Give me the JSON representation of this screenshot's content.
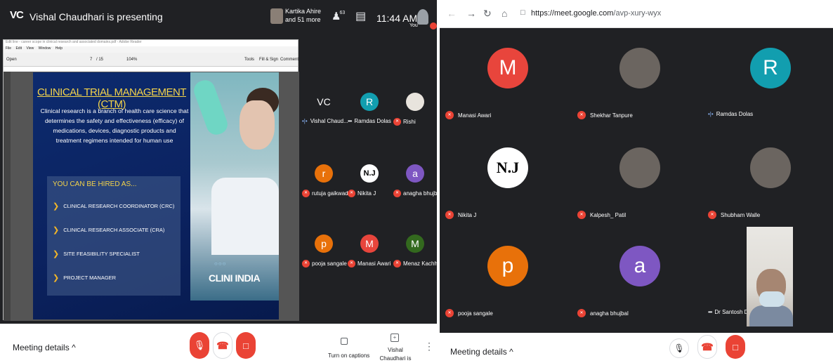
{
  "left": {
    "header": {
      "logo": "VC",
      "presenting_title": "Vishal Chaudhari is presenting",
      "participants_line1": "Kartika Ahire",
      "participants_line2": "and 51 more",
      "people_icon": "people-icon",
      "people_count": "63",
      "time": "11:44 AM",
      "you_label": "You"
    },
    "pdf": {
      "title": "Edit line - career scope in clinical research and associated domains.pdf - Adobe Reader",
      "menu": [
        "File",
        "Edit",
        "View",
        "Window",
        "Help"
      ],
      "open_label": "Open",
      "page_current": "7",
      "page_total": "/ 15",
      "zoom": "104%",
      "tools_label": "Tools",
      "fillsign_label": "Fill & Sign",
      "comment_label": "Comment"
    },
    "slide": {
      "title": "CLINICAL TRIAL MANAGEMENT (CTM)",
      "body": "Clinical research is a branch of health care science that determines the safety and effectiveness  (efficacy) of medications, devices, diagnostic products and treatment regimens intended for human use",
      "hire_heading": "YOU CAN BE HIRED AS...",
      "roles": [
        "CLINICAL RESEARCH COORDINATOR (CRC)",
        "CLINICAL RESEARCH ASSOCIATE (CRA)",
        "SITE FEASIBILITY SPECIALIST",
        "PROJECT MANAGER"
      ],
      "brand": "CLINI INDIA"
    },
    "participants": [
      {
        "name": "Vishal Chaud...",
        "initial": "VC",
        "color": "#202124",
        "status": "speaking"
      },
      {
        "name": "Ramdas Dolas",
        "initial": "R",
        "color": "#129eaf",
        "status": "dots"
      },
      {
        "name": "Rishi",
        "initial": "",
        "color": "#e8e4dd",
        "status": "muted"
      },
      {
        "name": "rutuja gaikwad",
        "initial": "r",
        "color": "#e8710a",
        "status": "muted"
      },
      {
        "name": "Nikita J",
        "initial": "N.J",
        "color": "#ffffff",
        "status": "muted"
      },
      {
        "name": "anagha bhujb...",
        "initial": "a",
        "color": "#7e57c2",
        "status": "muted"
      },
      {
        "name": "pooja sangale",
        "initial": "p",
        "color": "#e8710a",
        "status": "muted"
      },
      {
        "name": "Manasi Awari",
        "initial": "M",
        "color": "#e8453c",
        "status": "muted"
      },
      {
        "name": "Menaz Kachhi",
        "initial": "M",
        "color": "#33691e",
        "status": "muted"
      }
    ],
    "bottom": {
      "meeting_details": "Meeting details",
      "captions_label": "Turn on captions",
      "presenting_label": "Vishal Chaudhari is presenting"
    }
  },
  "right": {
    "url_host": "https://meet.google.com",
    "url_path": "/avp-xury-wyx",
    "participants": [
      {
        "name": "Manasi Awari",
        "initial": "M",
        "color": "#e8453c",
        "status": "muted"
      },
      {
        "name": "Shekhar Tanpure",
        "initial": "",
        "color": "#6b6560",
        "status": "muted"
      },
      {
        "name": "Ramdas Dolas",
        "initial": "R",
        "color": "#129eaf",
        "status": "speaking"
      },
      {
        "name": "Nikita J",
        "initial": "N.J",
        "color": "#ffffff",
        "status": "muted"
      },
      {
        "name": "Kalpesh_ Patil",
        "initial": "",
        "color": "#6b6560",
        "status": "muted"
      },
      {
        "name": "Shubham Walle",
        "initial": "",
        "color": "#6b6560",
        "status": "muted"
      },
      {
        "name": "pooja sangale",
        "initial": "p",
        "color": "#e8710a",
        "status": "muted"
      },
      {
        "name": "anagha bhujbal",
        "initial": "a",
        "color": "#7e57c2",
        "status": "muted"
      },
      {
        "name": "Dr Santosh Dighe",
        "initial": "",
        "color": "#dedbd5",
        "status": "dots"
      }
    ],
    "bottom": {
      "meeting_details": "Meeting details"
    }
  }
}
